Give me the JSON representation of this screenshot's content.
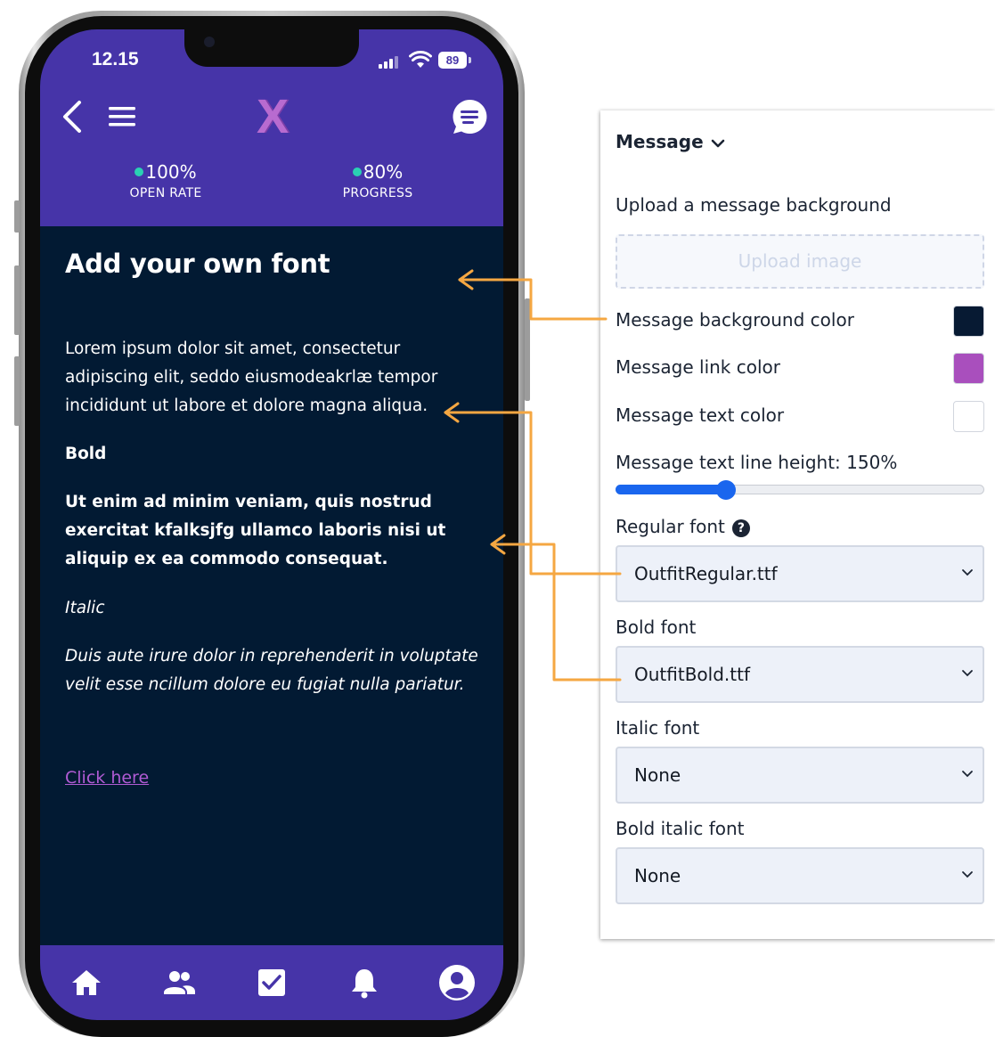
{
  "phone": {
    "status_time": "12.15",
    "battery": "89",
    "logo": "X",
    "metrics": [
      {
        "value": "100%",
        "label": "OPEN RATE",
        "dot_color": "#2ad0b3"
      },
      {
        "value": "80%",
        "label": "PROGRESS",
        "dot_color": "#2ad0b3"
      }
    ],
    "message": {
      "title": "Add your own font",
      "paragraph": "Lorem ipsum dolor sit amet, consectetur adipiscing elit, seddo eiusmodeakrlæ tempor incididunt ut labore et dolore magna aliqua.",
      "bold_label": "Bold",
      "bold_paragraph": "Ut enim ad minim veniam, quis nostrud exercitat kfalksjfg ullamco laboris nisi ut aliquip ex ea commodo consequat.",
      "italic_label": "Italic",
      "italic_paragraph": "Duis aute irure dolor in reprehenderit in voluptate velit esse ncillum dolore eu fugiat nulla pariatur.",
      "link": "Click here"
    },
    "tabs": [
      {
        "icon": "home-icon"
      },
      {
        "icon": "people-icon"
      },
      {
        "icon": "check-box-icon"
      },
      {
        "icon": "bell-icon"
      },
      {
        "icon": "profile-icon"
      }
    ],
    "colors": {
      "header": "#4634a8",
      "background": "#021a33",
      "link": "#b05bd4",
      "accent_arrow": "#f5a742"
    }
  },
  "panel": {
    "section_title": "Message",
    "upload_label": "Upload a message background",
    "upload_button": "Upload image",
    "bg_color_label": "Message background color",
    "bg_color": "#071a33",
    "link_color_label": "Message link color",
    "link_color": "#a94fbd",
    "text_color_label": "Message text color",
    "text_color": "#ffffff",
    "line_height_label": "Message text line height: 150%",
    "line_height_fraction": 0.3,
    "regular_font_label": "Regular font",
    "help_glyph": "?",
    "regular_font_value": "OutfitRegular.ttf",
    "bold_font_label": "Bold font",
    "bold_font_value": "OutfitBold.ttf",
    "italic_font_label": "Italic font",
    "italic_font_value": "None",
    "bold_italic_font_label": "Bold italic font",
    "bold_italic_font_value": "None"
  }
}
